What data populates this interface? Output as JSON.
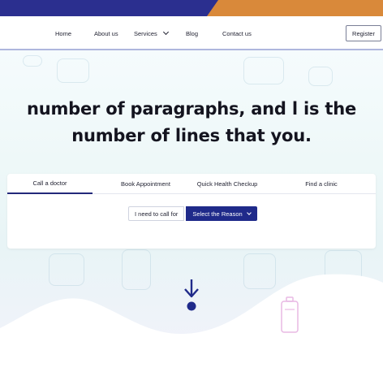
{
  "nav": {
    "items": [
      {
        "label": "Home"
      },
      {
        "label": "About us"
      },
      {
        "label": "Services"
      },
      {
        "label": "Blog"
      },
      {
        "label": "Contact us"
      }
    ],
    "register_label": "Register"
  },
  "hero": {
    "headline_line1": "number of paragraphs, and l is the",
    "headline_line2": "number of lines that you."
  },
  "tabs": [
    {
      "label": "Call a doctor",
      "active": true
    },
    {
      "label": "Book Appointment",
      "active": false
    },
    {
      "label": "Quick Health Checkup",
      "active": false
    },
    {
      "label": "Find a clinic",
      "active": false
    }
  ],
  "call_form": {
    "label": "I need to call for",
    "select_value": "Select the Reason"
  },
  "colors": {
    "topbar": "#2b2f8f",
    "topbar_accent": "#d9893a",
    "primary": "#1f2a8a"
  },
  "icons": {
    "services_dropdown": "chevron-down-icon",
    "select_dropdown": "chevron-down-icon",
    "scroll": "arrow-down-icon",
    "decor": "battery-icon"
  }
}
